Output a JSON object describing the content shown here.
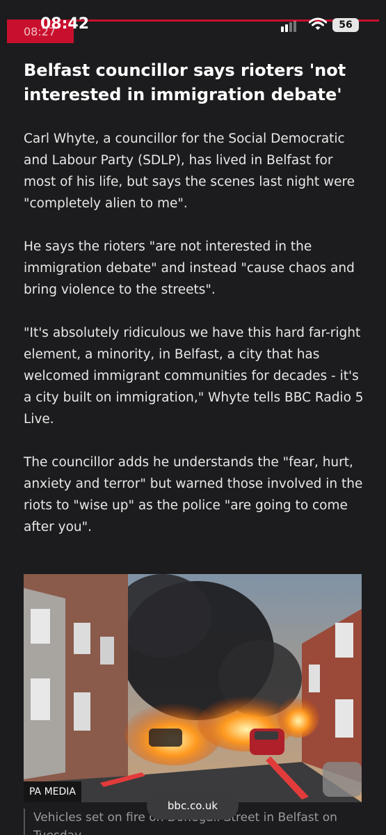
{
  "status_bar": {
    "time": "08:42",
    "under_time": "08:27",
    "battery": "56"
  },
  "article": {
    "headline": "Belfast councillor says rioters 'not interested in immigration debate'",
    "paragraphs": [
      "Carl Whyte, a councillor for the Social Democratic and Labour Party (SDLP), has lived in Belfast for most of his life, but says the scenes last night were \"completely alien to me\".",
      "He says the rioters \"are not interested in the immigration debate\" and instead \"cause chaos and bring violence to the streets\".",
      "\"It's absolutely ridiculous we have this hard far-right element, a minority, in Belfast, a city that has welcomed immigrant communities for decades - it's a city built on immigration,\" Whyte tells BBC Radio 5 Live.",
      "The councillor adds he understands the \"fear, hurt, anxiety and terror\" but warned those involved in the riots to \"wise up\" as the police \"are going to come after you\"."
    ],
    "image": {
      "credit": "PA MEDIA",
      "caption": "Vehicles set on fire on Donegall Street in Belfast on Tuesday"
    }
  },
  "browser": {
    "url": "bbc.co.uk"
  },
  "colors": {
    "accent": "#c8102e",
    "background": "#1c1c1e"
  }
}
